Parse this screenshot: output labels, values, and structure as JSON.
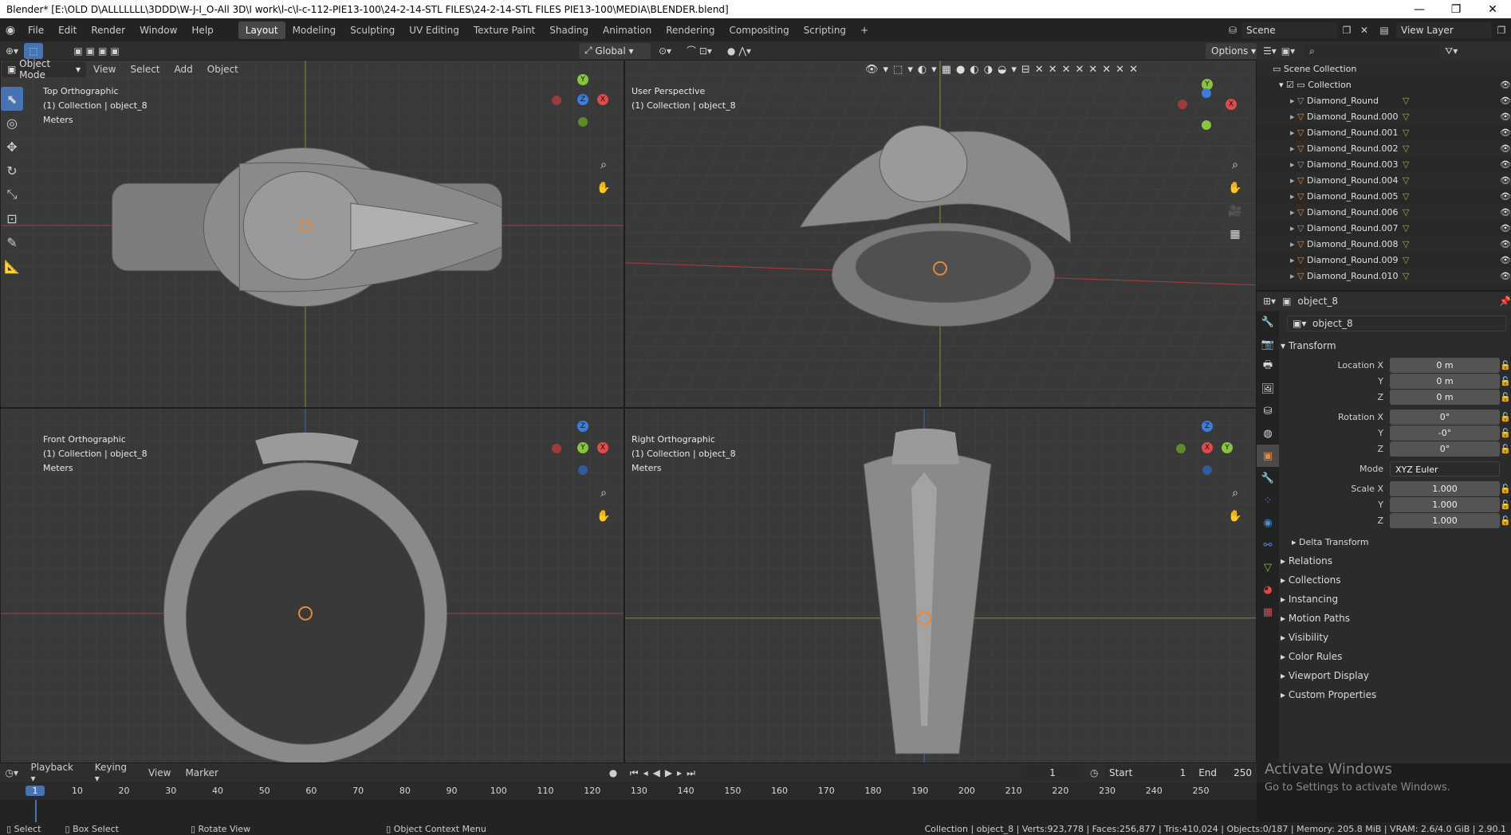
{
  "window": {
    "title": "Blender* [E:\\OLD D\\ALLLLLLL\\3DDD\\W-J-I_O-All 3D\\I work\\l-c\\l-c-112-PIE13-100\\24-2-14-STL FILES\\24-2-14-STL FILES PIE13-100\\MEDIA\\BLENDER.blend]",
    "minimize": "—",
    "restore": "❐",
    "close": "✕"
  },
  "menu": [
    "File",
    "Edit",
    "Render",
    "Window",
    "Help"
  ],
  "workspaces": [
    "Layout",
    "Modeling",
    "Sculpting",
    "UV Editing",
    "Texture Paint",
    "Shading",
    "Animation",
    "Rendering",
    "Compositing",
    "Scripting"
  ],
  "active_workspace": "Layout",
  "add_workspace": "+",
  "scene": {
    "label": "Scene",
    "view_layer": "View Layer"
  },
  "viewport_header": {
    "mode": "Object Mode",
    "view": "View",
    "select": "Select",
    "add": "Add",
    "object": "Object",
    "orientation": "Global",
    "options": "Options"
  },
  "viewports": [
    {
      "title": "Top Orthographic",
      "collection": "(1) Collection | object_8",
      "units": "Meters",
      "gizmo": [
        "Y",
        "Z",
        "X"
      ]
    },
    {
      "title": "User Perspective",
      "collection": "(1) Collection | object_8",
      "units": "",
      "gizmo": [
        "Y",
        "X"
      ]
    },
    {
      "title": "Front Orthographic",
      "collection": "(1) Collection | object_8",
      "units": "Meters",
      "gizmo": [
        "Z",
        "Y",
        "X"
      ]
    },
    {
      "title": "Right Orthographic",
      "collection": "(1) Collection | object_8",
      "units": "Meters",
      "gizmo": [
        "Z",
        "X",
        "Y"
      ]
    }
  ],
  "outliner": {
    "scene_collection": "Scene Collection",
    "collection": "Collection",
    "items": [
      "Diamond_Round",
      "Diamond_Round.000",
      "Diamond_Round.001",
      "Diamond_Round.002",
      "Diamond_Round.003",
      "Diamond_Round.004",
      "Diamond_Round.005",
      "Diamond_Round.006",
      "Diamond_Round.007",
      "Diamond_Round.008",
      "Diamond_Round.009",
      "Diamond_Round.010"
    ]
  },
  "properties": {
    "header_object": "object_8",
    "object_name": "object_8",
    "transform": "Transform",
    "location_label": "Location X",
    "location": [
      "0 m",
      "0 m",
      "0 m"
    ],
    "rotation_label": "Rotation X",
    "rotation": [
      "0°",
      "-0°",
      "0°"
    ],
    "mode_label": "Mode",
    "mode": "XYZ Euler",
    "scale_label": "Scale X",
    "scale": [
      "1.000",
      "1.000",
      "1.000"
    ],
    "y": "Y",
    "z": "Z",
    "delta": "Delta Transform",
    "sections": [
      "Relations",
      "Collections",
      "Instancing",
      "Motion Paths",
      "Visibility",
      "Color Rules",
      "Viewport Display",
      "Custom Properties"
    ]
  },
  "timeline": {
    "playback": "Playback",
    "keying": "Keying",
    "view": "View",
    "marker": "Marker",
    "current_frame": "1",
    "start_label": "Start",
    "start": "1",
    "end_label": "End",
    "end": "250",
    "ticks": [
      "1",
      "10",
      "20",
      "30",
      "40",
      "50",
      "60",
      "70",
      "80",
      "90",
      "100",
      "110",
      "120",
      "130",
      "140",
      "150",
      "160",
      "170",
      "180",
      "190",
      "200",
      "210",
      "220",
      "230",
      "240",
      "250"
    ]
  },
  "activate": {
    "title": "Activate Windows",
    "sub": "Go to Settings to activate Windows."
  },
  "status": {
    "select": "Select",
    "box_select": "Box Select",
    "rotate": "Rotate View",
    "context": "Object Context Menu",
    "stats": "Collection | object_8 | Verts:923,778 | Faces:256,877 | Tris:410,024 | Objects:0/187 | Memory: 205.8 MiB | VRAM: 2.6/4.0 GiB | 2.90.1"
  },
  "colors": {
    "accent": "#4772b3",
    "x_axis": "#e04a4a",
    "y_axis": "#8ac33c",
    "z_axis": "#3b7ddd",
    "orange": "#e8883a"
  }
}
